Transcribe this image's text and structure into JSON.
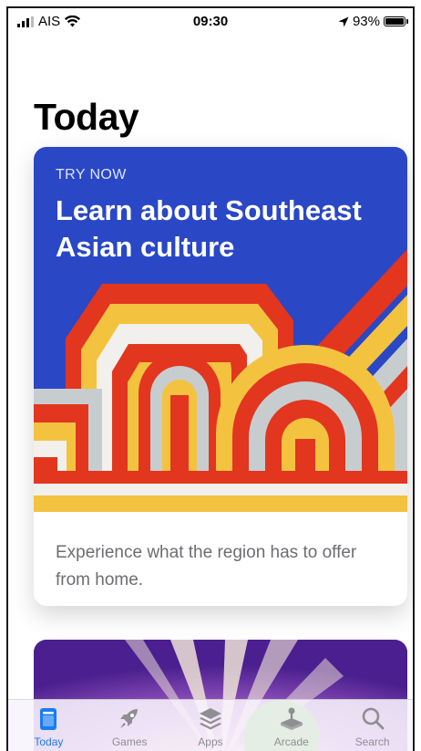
{
  "status_bar": {
    "carrier": "AIS",
    "time": "09:30",
    "battery": "93%"
  },
  "page_title": "Today",
  "featured_card": {
    "kicker": "TRY NOW",
    "headline": "Learn about Southeast Asian culture",
    "description": "Experience what the region has to offer from home."
  },
  "tabs": [
    {
      "label": "Today",
      "icon": "today-icon",
      "active": true
    },
    {
      "label": "Games",
      "icon": "rocket-icon",
      "active": false
    },
    {
      "label": "Apps",
      "icon": "layers-icon",
      "active": false
    },
    {
      "label": "Arcade",
      "icon": "joystick-icon",
      "active": false
    },
    {
      "label": "Search",
      "icon": "search-icon",
      "active": false
    }
  ],
  "colors": {
    "card_blue": "#2a47c6",
    "accent_red": "#e2361f",
    "accent_yellow": "#f3c33f",
    "accent_gray": "#c7cdcf",
    "active_tab": "#1a7cf5"
  }
}
